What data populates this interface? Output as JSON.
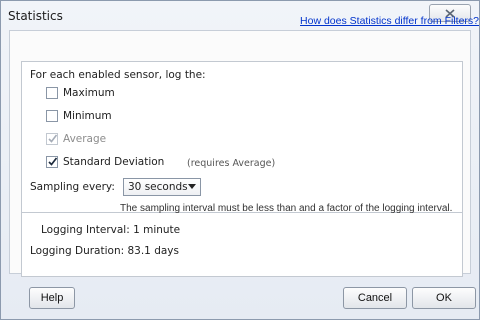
{
  "window": {
    "title": "Statistics"
  },
  "links": {
    "help_link": "How does Statistics differ from Filters?"
  },
  "options": {
    "heading": "For each enabled sensor, log the:",
    "items": [
      {
        "label": "Maximum",
        "checked": false,
        "disabled": false
      },
      {
        "label": "Minimum",
        "checked": false,
        "disabled": false
      },
      {
        "label": "Average",
        "checked": true,
        "disabled": true
      },
      {
        "label": "Standard Deviation",
        "suffix": "(requires Average)",
        "checked": true,
        "disabled": false
      }
    ]
  },
  "sampling": {
    "label": "Sampling every:",
    "selected": "30 seconds",
    "note": "The sampling interval must be less than and a factor of the logging interval."
  },
  "summary": {
    "logging_interval": "Logging Interval: 1 minute",
    "logging_duration": "Logging Duration: 83.1 days"
  },
  "buttons": {
    "help": "Help",
    "cancel": "Cancel",
    "ok": "OK"
  },
  "icons": {
    "close": "close-x-icon",
    "checkmark": "checkmark-icon",
    "dropdown": "chevron-down-icon"
  }
}
